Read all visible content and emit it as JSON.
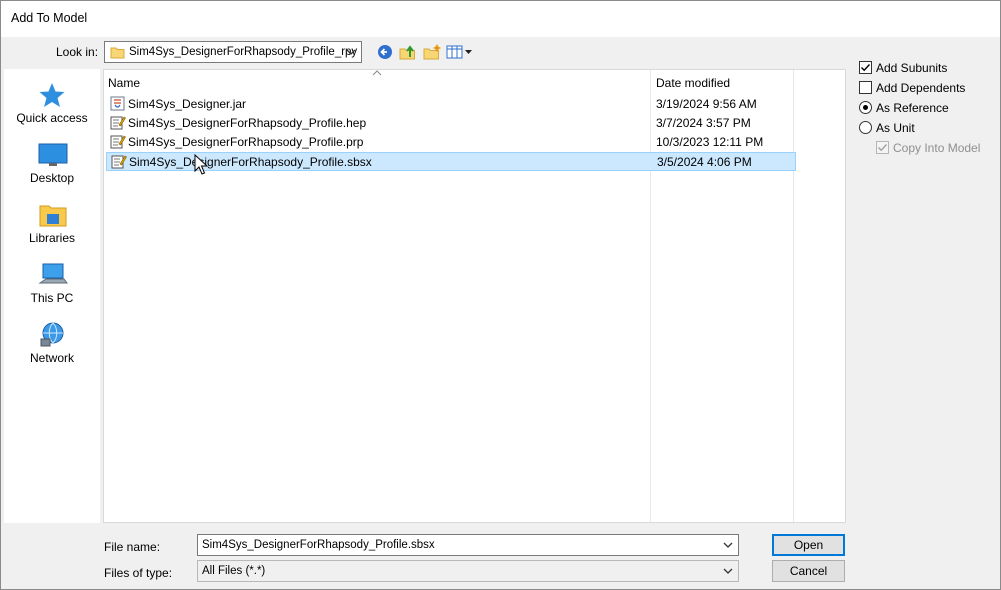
{
  "window": {
    "title": "Add To Model"
  },
  "look_in": {
    "label": "Look in:",
    "value": "Sim4Sys_DesignerForRhapsody_Profile_rpy"
  },
  "toolbar": {
    "icons": [
      "back-icon",
      "up-folder-icon",
      "new-folder-icon",
      "view-menu-icon"
    ]
  },
  "places": [
    {
      "label": "Quick access",
      "icon": "star-icon"
    },
    {
      "label": "Desktop",
      "icon": "desktop-icon"
    },
    {
      "label": "Libraries",
      "icon": "libraries-icon"
    },
    {
      "label": "This PC",
      "icon": "computer-icon"
    },
    {
      "label": "Network",
      "icon": "network-icon"
    }
  ],
  "columns": {
    "name": "Name",
    "date": "Date modified"
  },
  "files": [
    {
      "name": "Sim4Sys_Designer.jar",
      "date": "3/19/2024 9:56 AM",
      "icon": "jar-file-icon"
    },
    {
      "name": "Sim4Sys_DesignerForRhapsody_Profile.hep",
      "date": "3/7/2024 3:57 PM",
      "icon": "text-file-icon"
    },
    {
      "name": "Sim4Sys_DesignerForRhapsody_Profile.prp",
      "date": "10/3/2023 12:11 PM",
      "icon": "text-file-icon"
    },
    {
      "name": "Sim4Sys_DesignerForRhapsody_Profile.sbsx",
      "date": "3/5/2024 4:06 PM",
      "icon": "text-file-icon",
      "selected": true
    }
  ],
  "options": {
    "add_subunits": {
      "label": "Add Subunits",
      "checked": true
    },
    "add_dependents": {
      "label": "Add Dependents",
      "checked": false
    },
    "as_reference": {
      "label": "As Reference",
      "selected": true
    },
    "as_unit": {
      "label": "As Unit",
      "selected": false
    },
    "copy_into_model": {
      "label": "Copy Into Model",
      "checked": true,
      "disabled": true
    }
  },
  "file_name": {
    "label": "File name:",
    "value": "Sim4Sys_DesignerForRhapsody_Profile.sbsx"
  },
  "file_type": {
    "label": "Files of type:",
    "value": "All Files (*.*)"
  },
  "buttons": {
    "open": "Open",
    "cancel": "Cancel"
  },
  "colors": {
    "selection_bg": "#cce8ff",
    "selection_border": "#99d1ff",
    "default_button_border": "#0078d7",
    "dialog_bg": "#f0f0f0"
  }
}
